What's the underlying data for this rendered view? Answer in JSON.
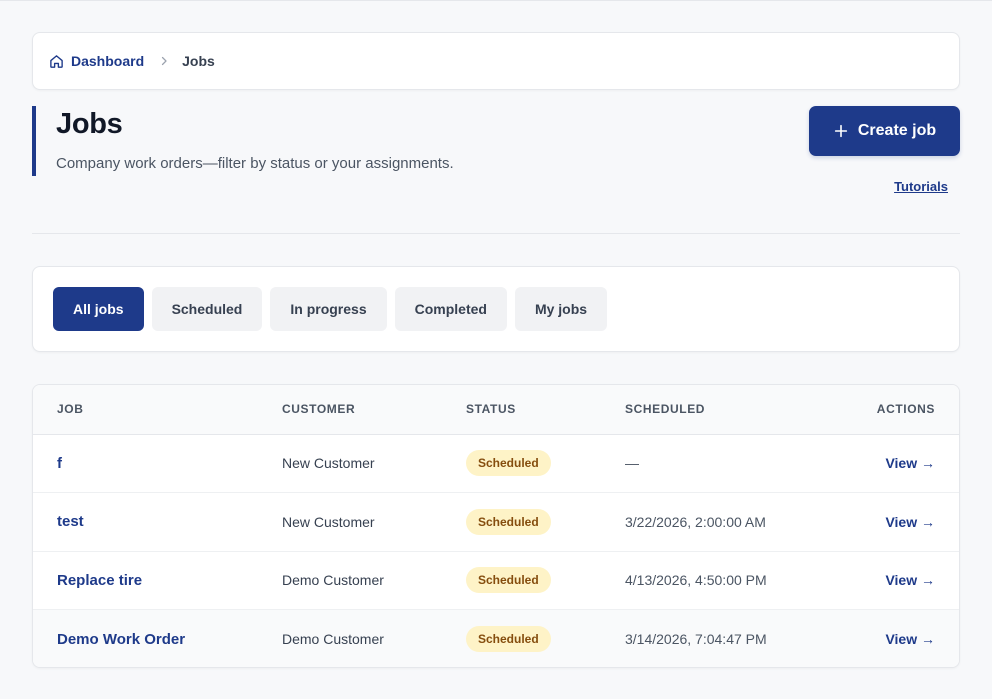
{
  "breadcrumb": {
    "home_label": "Dashboard",
    "current_label": "Jobs"
  },
  "header": {
    "title": "Jobs",
    "subtitle": "Company work orders—filter by status or your assignments.",
    "create_button_label": "Create job",
    "tutorials_link": "Tutorials"
  },
  "filters": [
    {
      "label": "All jobs",
      "active": true
    },
    {
      "label": "Scheduled",
      "active": false
    },
    {
      "label": "In progress",
      "active": false
    },
    {
      "label": "Completed",
      "active": false
    },
    {
      "label": "My jobs",
      "active": false
    }
  ],
  "table": {
    "columns": [
      "JOB",
      "CUSTOMER",
      "STATUS",
      "SCHEDULED",
      "ACTIONS"
    ],
    "rows": [
      {
        "job": "f",
        "customer": "New Customer",
        "status": "Scheduled",
        "scheduled": "—",
        "action": "View →"
      },
      {
        "job": "test",
        "customer": "New Customer",
        "status": "Scheduled",
        "scheduled": "3/22/2026, 2:00:00 AM",
        "action": "View →"
      },
      {
        "job": "Replace tire",
        "customer": "Demo Customer",
        "status": "Scheduled",
        "scheduled": "4/13/2026, 4:50:00 PM",
        "action": "View →"
      },
      {
        "job": "Demo Work Order",
        "customer": "Demo Customer",
        "status": "Scheduled",
        "scheduled": "3/14/2026, 7:04:47 PM",
        "action": "View →"
      }
    ]
  },
  "colors": {
    "primary": "#1e3a8a",
    "badge_bg": "#fef3c7",
    "badge_text": "#854d0e",
    "page_bg": "#f7f8fa"
  },
  "icons": {
    "home": "home-icon",
    "separator": "chevron-right-icon",
    "create": "plus-icon"
  }
}
